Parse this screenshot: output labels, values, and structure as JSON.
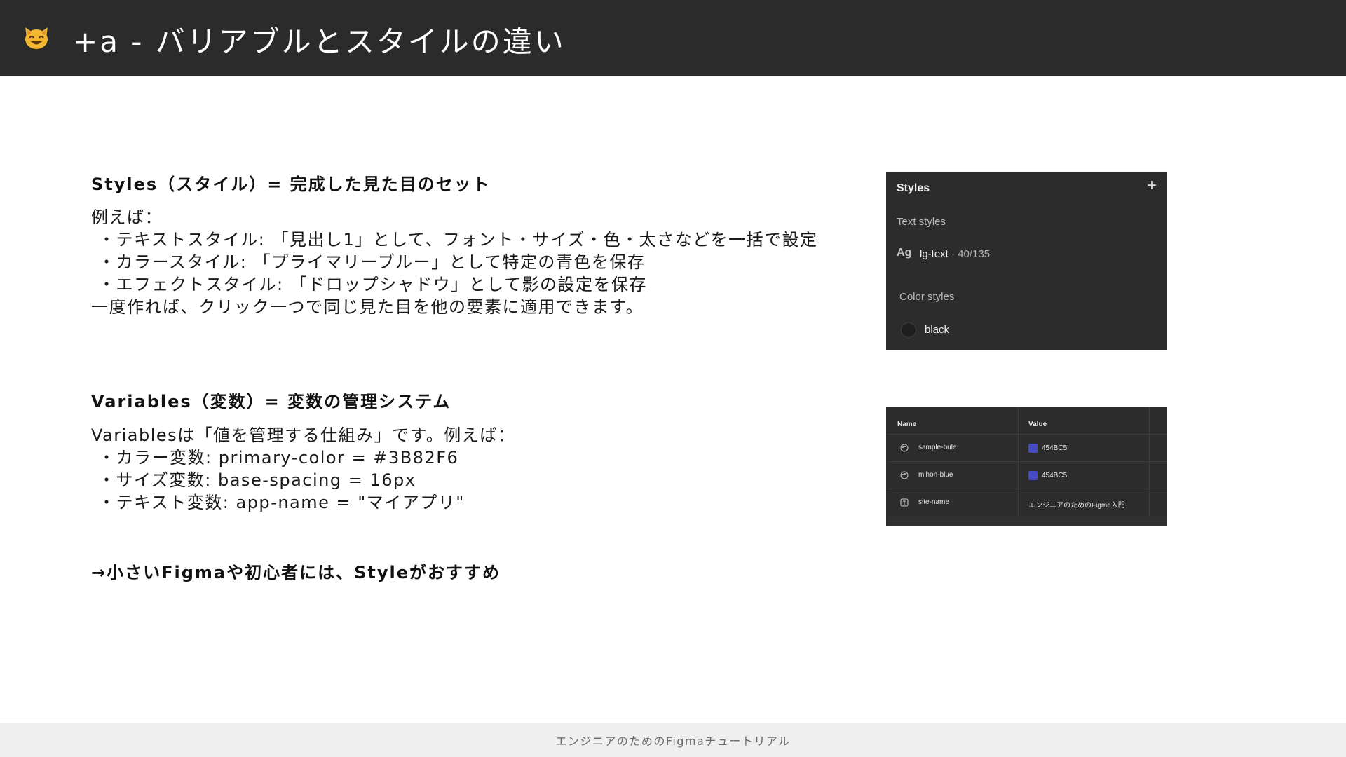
{
  "header": {
    "icon": "cat-face-emoji",
    "title": "+a - バリアブルとスタイルの違い"
  },
  "styles_section": {
    "heading": "Styles（スタイル）= 完成した見た目のセット",
    "lines": [
      "例えば：",
      "・テキストスタイル: 「見出し1」として、フォント・サイズ・色・太さなどを一括で設定",
      "・カラースタイル: 「プライマリーブルー」として特定の青色を保存",
      "・エフェクトスタイル: 「ドロップシャドウ」として影の設定を保存",
      "一度作れば、クリック一つで同じ見た目を他の要素に適用できます。"
    ]
  },
  "variables_section": {
    "heading": "Variables（変数）= 変数の管理システム",
    "lines": [
      "Variablesは「値を管理する仕組み」です。例えば：",
      "・カラー変数: primary-color = #3B82F6",
      "・サイズ変数: base-spacing = 16px",
      "・テキスト変数: app-name = \"マイアプリ\""
    ]
  },
  "recommendation": "→小さいFigmaや初心者には、Styleがおすすめ",
  "styles_panel": {
    "title": "Styles",
    "add_icon": "plus-icon",
    "text_styles_label": "Text styles",
    "ag_label": "Ag",
    "text_style_name": "lg-text",
    "text_style_meta": " · 40/135",
    "color_styles_label": "Color styles",
    "color_style_name": "black",
    "color_style_swatch": "#1f1f1f"
  },
  "variables_table": {
    "headers": {
      "name": "Name",
      "value": "Value"
    },
    "rows": [
      {
        "icon": "palette-icon",
        "name": "sample-bule",
        "value": "454BC5",
        "swatch": "#454bc5"
      },
      {
        "icon": "palette-icon",
        "name": "mihon-blue",
        "value": "454BC5",
        "swatch": "#454bc5"
      },
      {
        "icon": "text-icon",
        "name": "site-name",
        "value": "エンジニアのためのFigma入門"
      }
    ]
  },
  "footer": {
    "text": "エンジニアのためのFigmaチュートリアル"
  },
  "colors": {
    "header_bg": "#2b2b2b",
    "panel_bg": "#2c2c2c",
    "footer_bg": "#efefef",
    "accent_blue": "#454bc5"
  }
}
